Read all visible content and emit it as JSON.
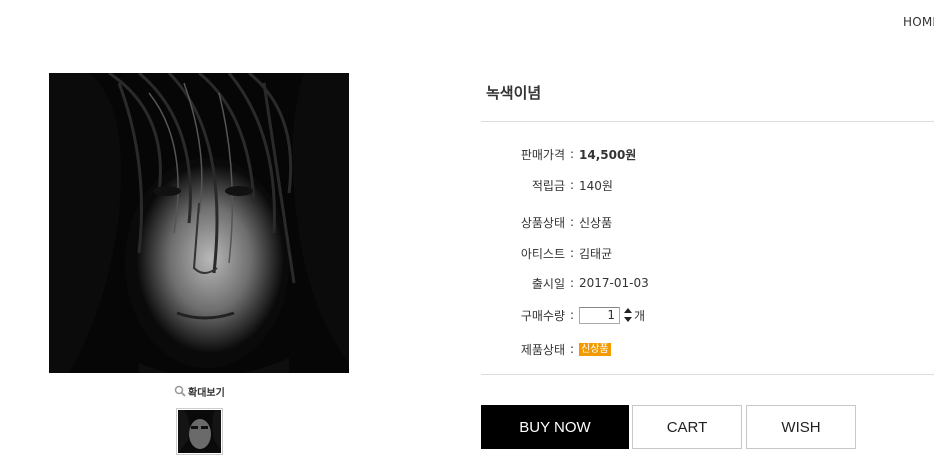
{
  "header": {
    "home_link": "HOME"
  },
  "gallery": {
    "zoom_label": "확대보기"
  },
  "product": {
    "title": "녹색이념",
    "rows": [
      {
        "label": "판매가격",
        "value": "14,500원"
      },
      {
        "label": "적립금",
        "value": "140원"
      },
      {
        "label": "상품상태",
        "value": "신상품"
      },
      {
        "label": "아티스트",
        "value": "김태균"
      },
      {
        "label": "출시일",
        "value": "2017-01-03"
      }
    ],
    "quantity": {
      "label": "구매수량",
      "value": "1",
      "unit": "개"
    },
    "condition": {
      "label": "제품상태",
      "badge": "신상품",
      "badge_color": "#f29a00"
    }
  },
  "actions": {
    "buy_now": "BUY NOW",
    "cart": "CART",
    "wish": "WISH"
  }
}
